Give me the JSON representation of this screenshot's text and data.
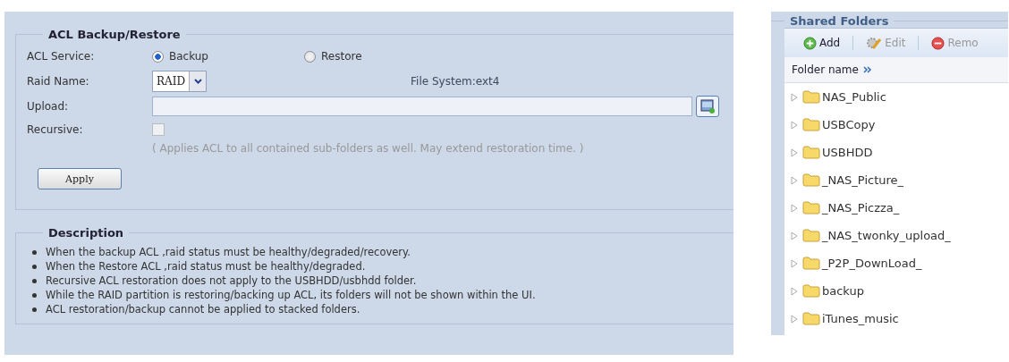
{
  "acl_panel": {
    "title": "ACL Backup/Restore",
    "service": {
      "label": "ACL Service:",
      "options": [
        {
          "label": "Backup",
          "selected": true
        },
        {
          "label": "Restore",
          "selected": false
        }
      ]
    },
    "raid": {
      "label": "Raid Name:",
      "value": "RAID",
      "file_system": "File System:ext4"
    },
    "upload": {
      "label": "Upload:"
    },
    "recursive": {
      "label": "Recursive:",
      "checked": false,
      "disabled": true,
      "hint": "( Applies ACL to all contained sub-folders as well. May extend restoration time. )"
    },
    "apply_button": "Apply"
  },
  "description": {
    "title": "Description",
    "items": [
      "When the backup ACL ,raid status must be healthy/degraded/recovery.",
      "When the Restore ACL ,raid status must be healthy/degraded.",
      "Recursive ACL restoration does not apply to the USBHDD/usbhdd folder.",
      "While the RAID partition is restoring/backing up ACL, its folders will not be shown within the UI.",
      "ACL restoration/backup cannot be applied to stacked folders."
    ]
  },
  "shared_folders": {
    "title": "Shared Folders",
    "toolbar": [
      {
        "kind": "add",
        "label": "Add",
        "disabled": false
      },
      {
        "kind": "edit",
        "label": "Edit",
        "disabled": true
      },
      {
        "kind": "remove",
        "label": "Remo",
        "disabled": true
      }
    ],
    "column": "Folder name",
    "folders": [
      "NAS_Public",
      "USBCopy",
      "USBHDD",
      "_NAS_Picture_",
      "_NAS_Piczza_",
      "_NAS_twonky_upload_",
      "_P2P_DownLoad_",
      "backup",
      "iTunes_music"
    ]
  }
}
